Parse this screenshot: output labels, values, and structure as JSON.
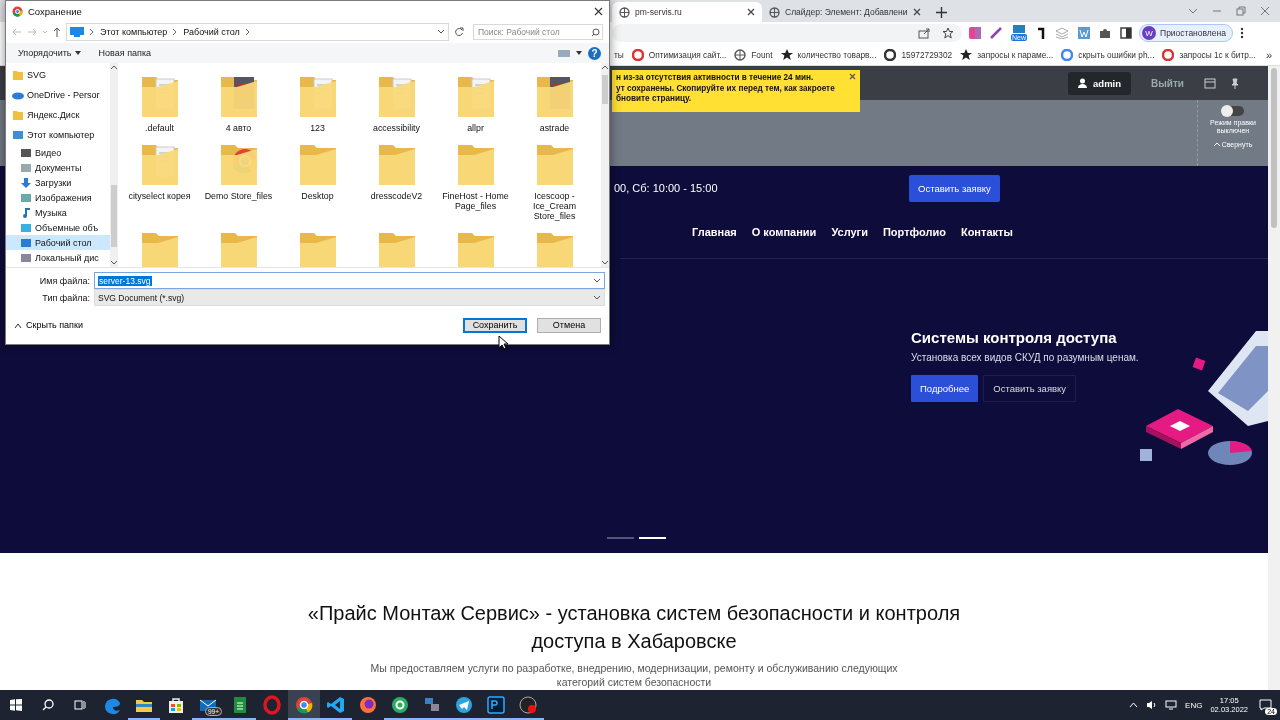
{
  "dialog": {
    "title": "Сохранение",
    "breadcrumbs": [
      "Этот компьютер",
      "Рабочий стол"
    ],
    "search": {
      "placeholder": "Поиск: Рабочий стол"
    },
    "toolbar": {
      "organize": "Упорядочить",
      "new_folder": "Новая папка",
      "help": "?"
    },
    "nav": [
      {
        "label": "SVG",
        "kind": "folder",
        "selected": false
      },
      {
        "label": "OneDrive - Persor",
        "kind": "cloud",
        "selected": false
      },
      {
        "label": "Яндекс.Диск",
        "kind": "folder",
        "selected": false
      },
      {
        "label": "Этот компьютер",
        "kind": "computer",
        "selected": false,
        "children": [
          {
            "label": "Видео",
            "kind": "video",
            "selected": false
          },
          {
            "label": "Документы",
            "kind": "docs",
            "selected": false
          },
          {
            "label": "Загрузки",
            "kind": "download",
            "selected": false
          },
          {
            "label": "Изображения",
            "kind": "pictures",
            "selected": false
          },
          {
            "label": "Музыка",
            "kind": "music",
            "selected": false
          },
          {
            "label": "Объемные объ",
            "kind": "objects",
            "selected": false
          },
          {
            "label": "Рабочий стол",
            "kind": "desktop",
            "selected": true
          },
          {
            "label": "Локальный дис",
            "kind": "disk",
            "selected": false
          }
        ]
      }
    ],
    "files": [
      {
        "label": ".default",
        "kind": "docs"
      },
      {
        "label": "4 авто",
        "kind": "photo"
      },
      {
        "label": "123",
        "kind": "docs"
      },
      {
        "label": "accessibility",
        "kind": "docs"
      },
      {
        "label": "allpr",
        "kind": "docs"
      },
      {
        "label": "astrade",
        "kind": "photo"
      },
      {
        "label": "cityselect корея",
        "kind": "docs"
      },
      {
        "label": "Demo Store_files",
        "kind": "browser"
      },
      {
        "label": "Desktop",
        "kind": "plain"
      },
      {
        "label": "dresscodeV2",
        "kind": "plain"
      },
      {
        "label": "FineHost - Home Page_files",
        "kind": "plain"
      },
      {
        "label": "Icescoop - Ice_Cream Store_files",
        "kind": "plain"
      },
      {
        "kind": "plain"
      },
      {
        "kind": "plain"
      },
      {
        "kind": "plain"
      },
      {
        "kind": "plain"
      },
      {
        "kind": "plain"
      },
      {
        "kind": "plain"
      }
    ],
    "filename": {
      "label": "Имя файла:",
      "value": "server-13.svg"
    },
    "filetype": {
      "label": "Тип файла:",
      "value": "SVG Document (*.svg)"
    },
    "hide_folders": "Скрыть папки",
    "buttons": [
      {
        "label": "Сохранить",
        "default": true
      },
      {
        "label": "Отмена",
        "default": false
      }
    ]
  },
  "browser": {
    "tabs": [
      {
        "label": "pm-servis.ru",
        "selected": true
      },
      {
        "label": "Слайдер: Элемент: Добавлени",
        "selected": false
      }
    ],
    "toolbar": {
      "extension_badge": "New",
      "profile": {
        "initial": "W",
        "label": "Приостановлена"
      }
    },
    "bookmarks": [
      {
        "label": "ты",
        "kind": "none"
      },
      {
        "label": "Оптимизация сайт...",
        "kind": "ring"
      },
      {
        "label": "Fount",
        "kind": "globe"
      },
      {
        "label": "количество товарв...",
        "kind": "star"
      },
      {
        "label": "15972729302",
        "kind": "lens"
      },
      {
        "label": "запросы к параме...",
        "kind": "star"
      },
      {
        "label": "скрыть ошибки ph...",
        "kind": "google"
      },
      {
        "label": "запросы 1с к битр...",
        "kind": "ring"
      }
    ],
    "more_bookmarks": "»",
    "page": {
      "notification": {
        "lines": [
          "н из-за отсутствия активности в течение 24 мин.",
          "ут сохранены. Скопируйте их перед тем, как закроете",
          "бновите страницу."
        ]
      },
      "admin": {
        "user": "admin",
        "logout": "Выйти"
      },
      "edit_panel": {
        "on": false,
        "label": "Режим правки выключен",
        "collapse": "Свернуть"
      },
      "site": {
        "hours": "00, Сб: 10:00 - 15:00",
        "request_button": "Оставить заявку",
        "nav": [
          "Главная",
          "О компании",
          "Услуги",
          "Портфолио",
          "Контакты"
        ],
        "hero": {
          "title": "Системы контроля доступа",
          "subtitle": "Установка всех видов СКУД по разумным ценам.",
          "buttons": [
            {
              "label": "Подробнее",
              "kind": "primary"
            },
            {
              "label": "Оставить заявку",
              "kind": "outline"
            }
          ]
        },
        "slides": [
          {
            "selected": false
          },
          {
            "selected": true
          }
        ],
        "intro": {
          "heading": "«Прайс Монтаж Сервис» - установка систем безопасности и контроля доступа в Хабаровске",
          "text": "Мы предоставляем услуги по разработке, внедрению, модернизации, ремонту и обслуживанию следующих категорий систем безопасности"
        }
      }
    }
  },
  "taskbar": {
    "apps": [
      {
        "kind": "edge",
        "running": false,
        "active": false
      },
      {
        "kind": "explorer",
        "running": true,
        "active": false
      },
      {
        "kind": "store",
        "running": false,
        "active": false
      },
      {
        "kind": "mail",
        "running": true,
        "active": false,
        "badge": "99+"
      },
      {
        "kind": "sheets",
        "running": true,
        "active": false
      },
      {
        "kind": "opera",
        "running": false,
        "active": false
      },
      {
        "kind": "chrome",
        "running": true,
        "active": true
      },
      {
        "kind": "vscode",
        "running": true,
        "active": false
      },
      {
        "kind": "firefox",
        "running": false,
        "active": false
      },
      {
        "kind": "at",
        "running": true,
        "active": false
      },
      {
        "kind": "network",
        "running": true,
        "active": false
      },
      {
        "kind": "telegram",
        "running": true,
        "active": false
      },
      {
        "kind": "photoshop",
        "running": true,
        "active": false
      },
      {
        "kind": "recorder",
        "running": true,
        "active": false
      }
    ],
    "language": "ENG",
    "time": "17:05",
    "date": "02.03.2022",
    "notifications": "24"
  }
}
